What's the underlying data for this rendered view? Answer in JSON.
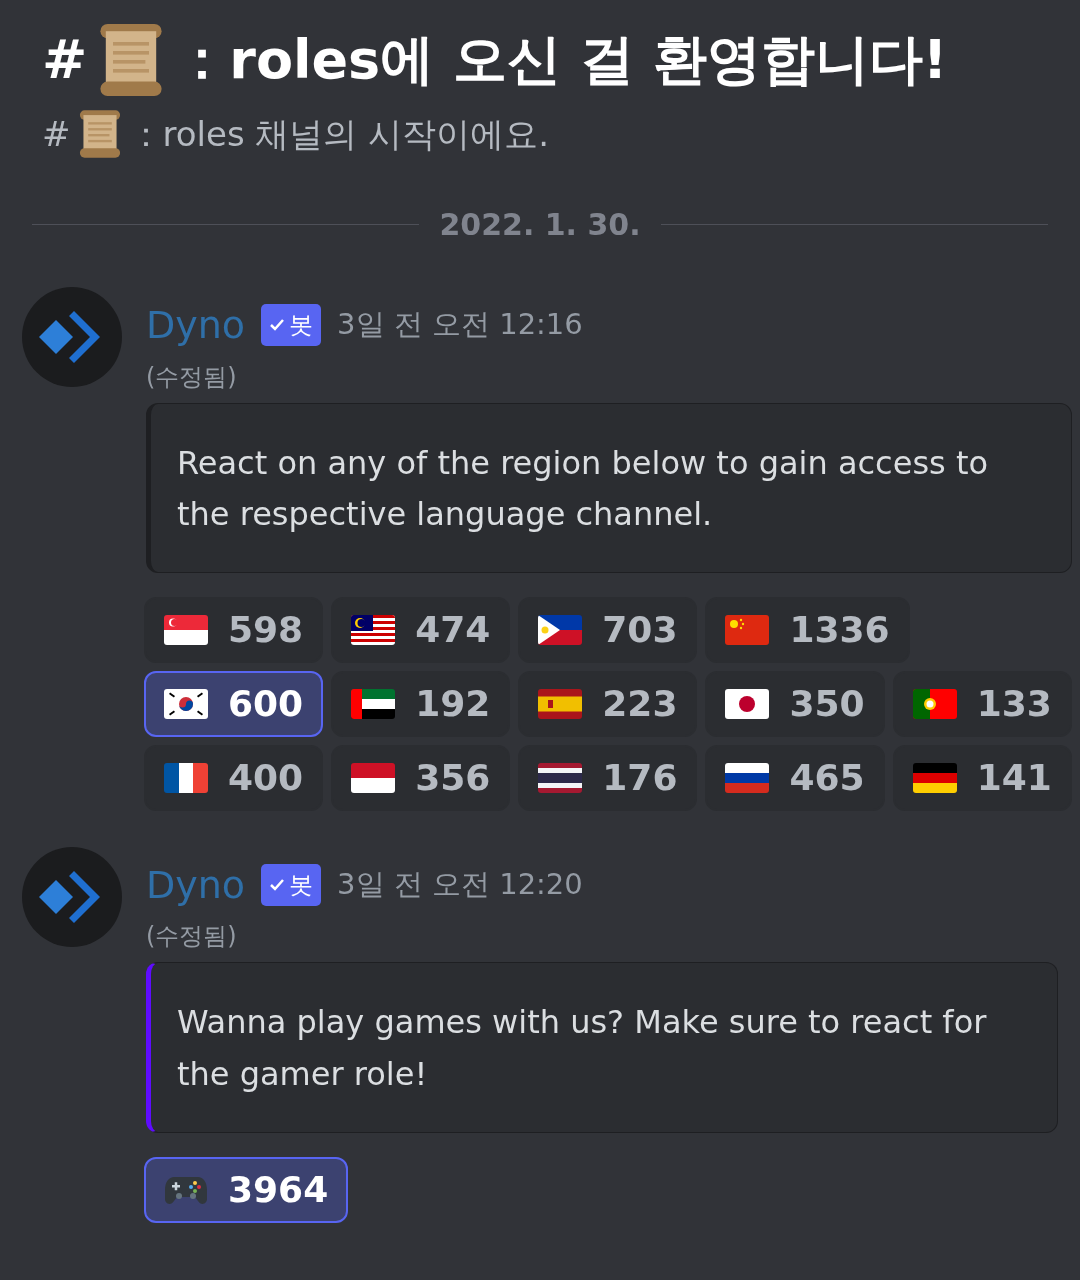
{
  "channel_header": {
    "title_prefix": "#",
    "title": "：roles에 오신 걸 환영합니다!",
    "subtitle_prefix": "#",
    "subtitle": "：roles 채널의 시작이에요."
  },
  "date_divider": "2022. 1. 30.",
  "messages": [
    {
      "author": "Dyno",
      "bot_tag": "봇",
      "timestamp": "3일 전 오전 12:16",
      "edited": "(수정됨)",
      "embed": {
        "color": "#1e1f22",
        "text": "React on any of the region below to gain access to the respective language channel."
      },
      "reaction_rows": [
        [
          {
            "kind": "sg",
            "count": "598",
            "selected": false
          },
          {
            "kind": "my",
            "count": "474",
            "selected": false
          },
          {
            "kind": "ph",
            "count": "703",
            "selected": false
          },
          {
            "kind": "cn",
            "count": "1336",
            "selected": false
          }
        ],
        [
          {
            "kind": "kr",
            "count": "600",
            "selected": true
          },
          {
            "kind": "ae",
            "count": "192",
            "selected": false
          },
          {
            "kind": "es",
            "count": "223",
            "selected": false
          },
          {
            "kind": "jp",
            "count": "350",
            "selected": false
          },
          {
            "kind": "pt",
            "count": "133",
            "selected": false
          }
        ],
        [
          {
            "kind": "fr",
            "count": "400",
            "selected": false
          },
          {
            "kind": "id",
            "count": "356",
            "selected": false
          },
          {
            "kind": "th",
            "count": "176",
            "selected": false
          },
          {
            "kind": "ru",
            "count": "465",
            "selected": false
          },
          {
            "kind": "de",
            "count": "141",
            "selected": false
          }
        ]
      ]
    },
    {
      "author": "Dyno",
      "bot_tag": "봇",
      "timestamp": "3일 전 오전 12:20",
      "edited": "(수정됨)",
      "embed": {
        "color": "#5f0cff",
        "text": "Wanna play games with us? Make sure to react for the gamer role!"
      },
      "reaction_rows": [
        [
          {
            "kind": "gamepad",
            "count": "3964",
            "selected": true
          }
        ]
      ]
    }
  ]
}
